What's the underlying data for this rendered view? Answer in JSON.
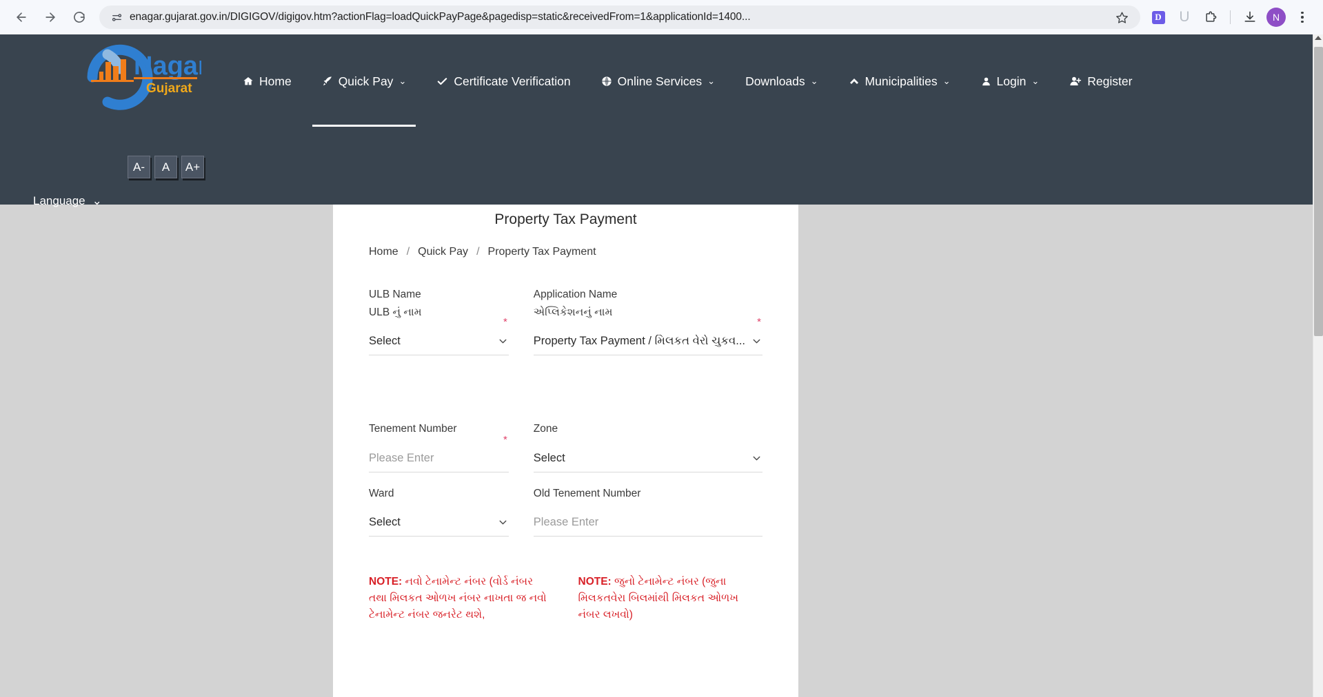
{
  "browser": {
    "url": "enagar.gujarat.gov.in/DIGIGOV/digigov.htm?actionFlag=loadQuickPayPage&pagedisp=static&receivedFrom=1&applicationId=1400...",
    "back_icon": "back-arrow-icon",
    "forward_icon": "forward-arrow-icon",
    "reload_icon": "reload-icon",
    "site_info_icon": "site-settings-icon",
    "bookmark_icon": "star-icon",
    "extension_d_label": "D",
    "extension_u_label": "U",
    "extension_puzzle_icon": "puzzle-icon",
    "download_icon": "download-icon",
    "profile_initial": "N",
    "menu_icon": "kebab-menu-icon"
  },
  "site": {
    "logo": {
      "brand": "Nagar",
      "sub": "Gujarat",
      "e_mark": "e"
    },
    "nav": [
      {
        "label": "Home",
        "icon": "home-icon",
        "caret": "",
        "name": "nav-home"
      },
      {
        "label": "Quick Pay",
        "icon": "rocket-icon",
        "caret": "⌄",
        "name": "nav-quick-pay"
      },
      {
        "label": "Certificate Verification",
        "icon": "check-icon",
        "caret": "",
        "name": "nav-certificate-verification"
      },
      {
        "label": "Online Services",
        "icon": "globe-icon",
        "caret": "⌄",
        "name": "nav-online-services"
      },
      {
        "label": "Downloads",
        "icon": "",
        "caret": "⌄",
        "name": "nav-downloads"
      },
      {
        "label": "Municipalities",
        "icon": "building-icon",
        "caret": "⌄",
        "name": "nav-municipalities"
      },
      {
        "label": "Login",
        "icon": "user-icon",
        "caret": "⌄",
        "name": "nav-login"
      },
      {
        "label": "Register",
        "icon": "user-plus-icon",
        "caret": "",
        "name": "nav-register"
      }
    ],
    "font_size": {
      "decrease": "A-",
      "normal": "A",
      "increase": "A+"
    },
    "language": {
      "label": "Language",
      "caret": "⌄"
    },
    "colors": {
      "header_bg": "#39444f",
      "page_bg": "#d3d3d3",
      "card_bg": "#ffffff",
      "note_red": "#d81f26",
      "required_star": "#e0426a",
      "logo_blue": "#2f7fd1",
      "logo_orange": "#f07d1a"
    }
  },
  "page": {
    "title": "Property Tax Payment",
    "breadcrumb": [
      {
        "label": "Home",
        "name": "breadcrumb-home"
      },
      {
        "label": "Quick Pay",
        "name": "breadcrumb-quick-pay"
      },
      {
        "label": "Property Tax Payment",
        "name": "breadcrumb-current"
      }
    ],
    "breadcrumb_separator": "/",
    "form": {
      "ulb_name": {
        "label_en": "ULB Name",
        "label_gu": "ULB નું નામ",
        "required": "*",
        "value": "Select",
        "caret": "chevron-down-icon"
      },
      "application_name": {
        "label_en": "Application Name",
        "label_gu": "એપ્લિકેશનનું નામ",
        "required": "*",
        "value": "Property Tax Payment / મિલકત વેરો ચુકવ...",
        "caret": "chevron-down-icon"
      },
      "tenement_number": {
        "label_en": "Tenement Number",
        "required": "*",
        "placeholder": "Please Enter",
        "value": ""
      },
      "zone": {
        "label_en": "Zone",
        "value": "Select",
        "caret": "chevron-down-icon"
      },
      "ward": {
        "label_en": "Ward",
        "value": "Select",
        "caret": "chevron-down-icon"
      },
      "old_tenement_number": {
        "label_en": "Old Tenement Number",
        "placeholder": "Please Enter",
        "value": ""
      }
    },
    "notes": {
      "left_prefix": "NOTE:",
      "left_text": " નવો ટેનામેન્ટ નંબર (વોર્ડ નંબર તથા મિલકત ઓળખ નંબર નાખતા જ નવો ટેનામેન્ટ નંબર જનરેટ થશે,",
      "right_prefix": "NOTE:",
      "right_text": " જુનો ટેનામેન્ટ નંબર (જુના મિલકતવેરા બિલમાંથી મિલકત ઓળખ નંબર લખવો)"
    }
  }
}
